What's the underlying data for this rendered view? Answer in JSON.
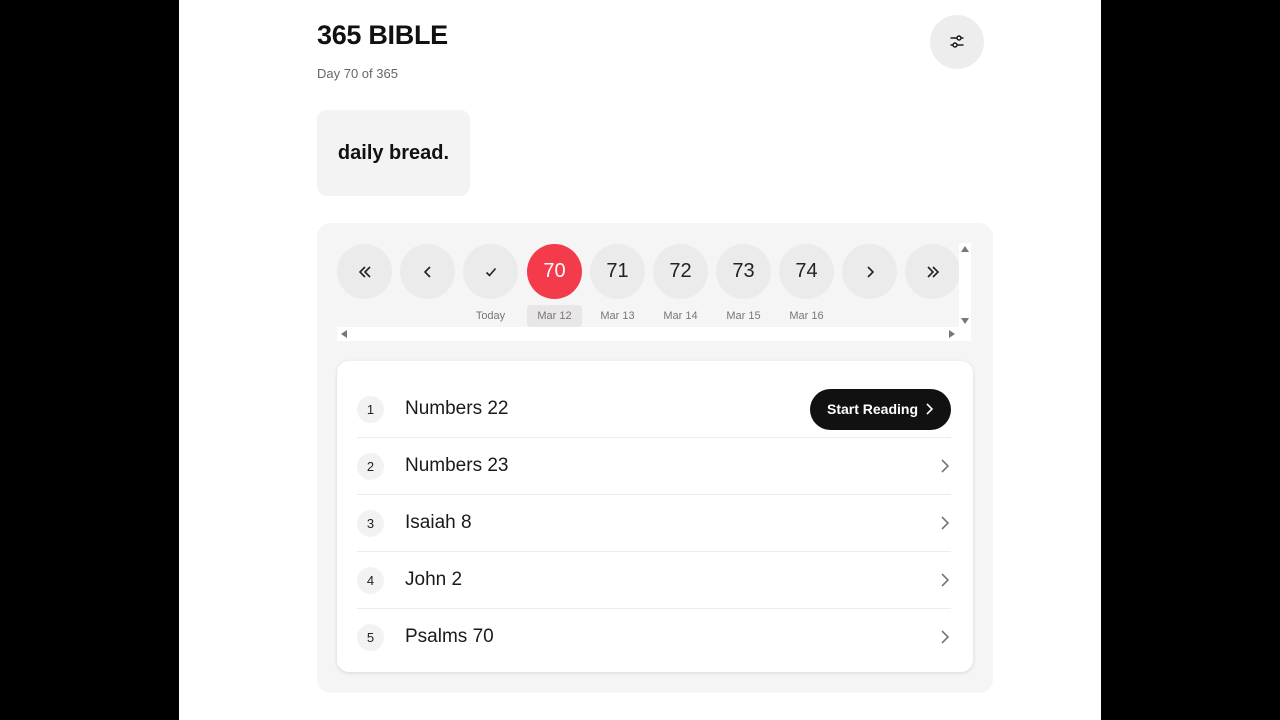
{
  "header": {
    "app_title": "365 BIBLE",
    "day_subtitle": "Day 70 of 365",
    "settings_icon": "sliders-icon"
  },
  "brand": {
    "text": "daily bread."
  },
  "day_selector": {
    "nav": [
      {
        "name": "first-day",
        "icon": "double-chevron-left-icon"
      },
      {
        "name": "previous-day",
        "icon": "chevron-left-icon"
      },
      {
        "name": "today",
        "icon": "check-icon",
        "label": "Today"
      }
    ],
    "days": [
      {
        "number": "70",
        "date": "Mar 12",
        "active": true
      },
      {
        "number": "71",
        "date": "Mar 13",
        "active": false
      },
      {
        "number": "72",
        "date": "Mar 14",
        "active": false
      },
      {
        "number": "73",
        "date": "Mar 15",
        "active": false
      },
      {
        "number": "74",
        "date": "Mar 16",
        "active": false
      }
    ],
    "forward_nav": [
      {
        "name": "next-day",
        "icon": "chevron-right-icon"
      },
      {
        "name": "last-day",
        "icon": "double-chevron-right-icon"
      }
    ],
    "active_color": "#f43b4c"
  },
  "readings": {
    "start_label": "Start Reading",
    "items": [
      {
        "index": "1",
        "title": "Numbers 22"
      },
      {
        "index": "2",
        "title": "Numbers 23"
      },
      {
        "index": "3",
        "title": "Isaiah 8"
      },
      {
        "index": "4",
        "title": "John 2"
      },
      {
        "index": "5",
        "title": "Psalms 70"
      }
    ]
  }
}
